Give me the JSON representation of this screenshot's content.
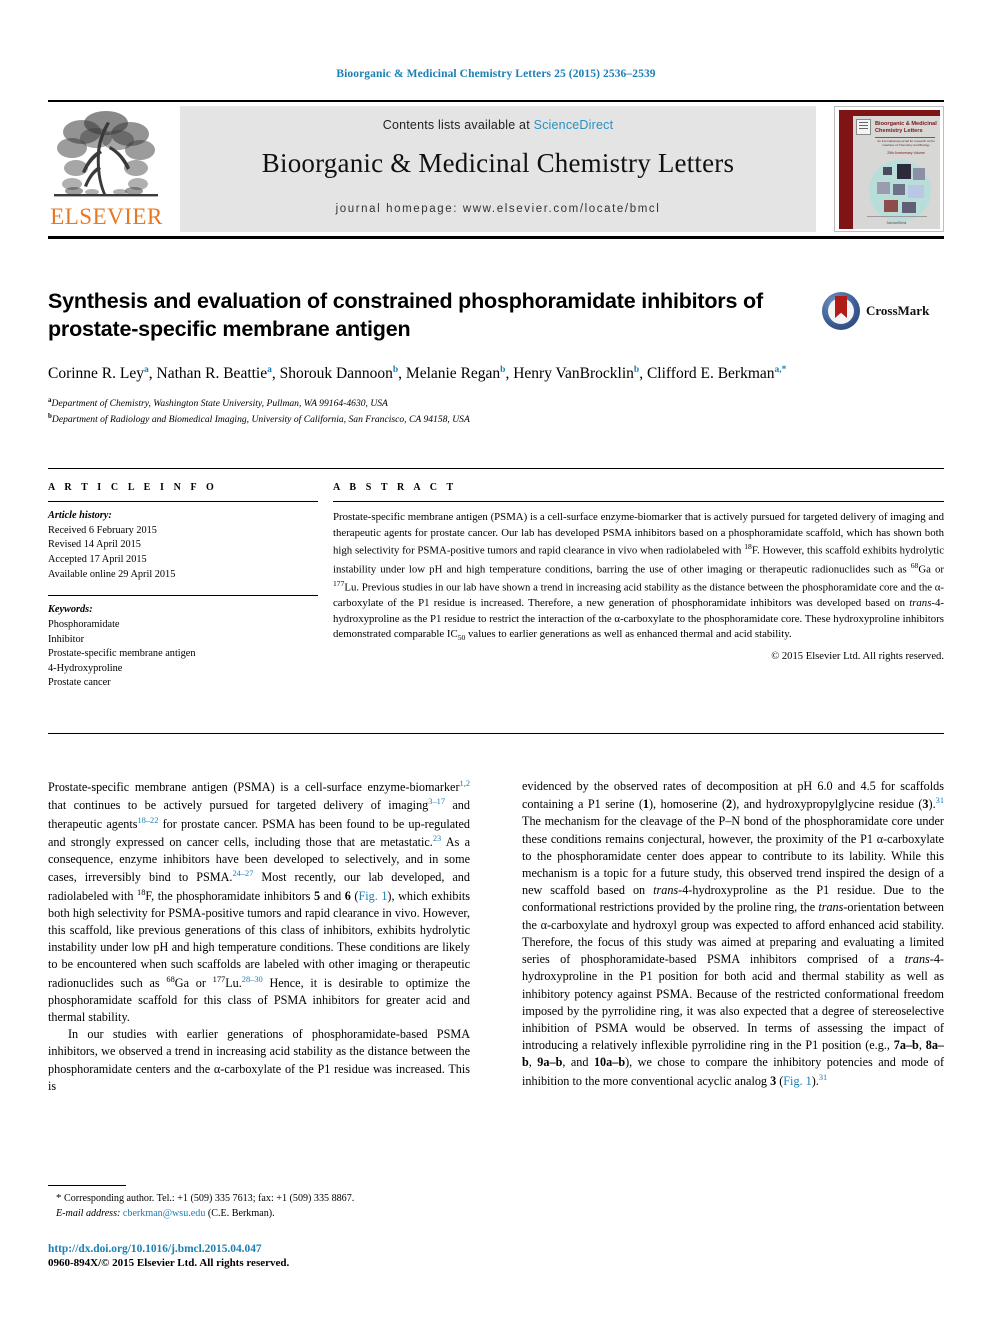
{
  "running_head": "Bioorganic & Medicinal Chemistry Letters 25 (2015) 2536–2539",
  "masthead": {
    "publisher_name": "ELSEVIER",
    "contents_prefix": "Contents lists available at",
    "sciencedirect_label": "ScienceDirect",
    "journal_title": "Bioorganic & Medicinal Chemistry Letters",
    "homepage_label": "journal homepage: www.elsevier.com/locate/bmcl",
    "cover": {
      "title": "Bioorganic & Medicinal Chemistry Letters",
      "subtitle": "An international journal for research at the interface of Chemistry and Biology",
      "volume_note": "25th Anniversary Volume",
      "footer": "ScienceDirect"
    },
    "colors": {
      "link_blue": "#2b8fc4",
      "elsevier_orange": "#e87722",
      "banner_grey": "#e4e4e4",
      "cover_red": "#7e1416"
    }
  },
  "article": {
    "title": "Synthesis and evaluation of constrained phosphoramidate inhibitors of prostate-specific membrane antigen",
    "crossmark_label": "CrossMark",
    "authors_html": "Corinne R. Ley<sup>a</sup>, Nathan R. Beattie<sup>a</sup>, Shorouk Dannoon<sup>b</sup>, Melanie Regan<sup>b</sup>, Henry VanBrocklin<sup>b</sup>, Clifford E. Berkman<sup>a,*</sup>",
    "affiliations": [
      {
        "marker": "a",
        "text": "Department of Chemistry, Washington State University, Pullman, WA 99164-4630, USA"
      },
      {
        "marker": "b",
        "text": "Department of Radiology and Biomedical Imaging, University of California, San Francisco, CA 94158, USA"
      }
    ]
  },
  "article_info": {
    "heading": "A R T I C L E    I N F O",
    "history_label": "Article history:",
    "history": [
      "Received 6 February 2015",
      "Revised 14 April 2015",
      "Accepted 17 April 2015",
      "Available online 29 April 2015"
    ],
    "keywords_label": "Keywords:",
    "keywords": [
      "Phosphoramidate",
      "Inhibitor",
      "Prostate-specific membrane antigen",
      "4-Hydroxyproline",
      "Prostate cancer"
    ]
  },
  "abstract": {
    "heading": "A B S T R A C T",
    "text_html": "Prostate-specific membrane antigen (PSMA) is a cell-surface enzyme-biomarker that is actively pursued for targeted delivery of imaging and therapeutic agents for prostate cancer. Our lab has developed PSMA inhibitors based on a phosphoramidate scaffold, which has shown both high selectivity for PSMA-positive tumors and rapid clearance in vivo when radiolabeled with <sup>18</sup>F. However, this scaffold exhibits hydrolytic instability under low pH and high temperature conditions, barring the use of other imaging or therapeutic radionuclides such as <sup>68</sup>Ga or <sup>177</sup>Lu. Previous studies in our lab have shown a trend in increasing acid stability as the distance between the phosphoramidate core and the &alpha;-carboxylate of the P1 residue is increased. Therefore, a new generation of phosphoramidate inhibitors was developed based on <i>trans</i>-4-hydroxyproline as the P1 residue to restrict the interaction of the &alpha;-carboxylate to the phosphoramidate core. These hydroxyproline inhibitors demonstrated comparable IC<sub>50</sub> values to earlier generations as well as enhanced thermal and acid stability.",
    "copyright": "© 2015 Elsevier Ltd. All rights reserved."
  },
  "body": {
    "left_column_html": "<p class=\"noindent\">Prostate-specific membrane antigen (PSMA) is a cell-surface enzyme-biomarker<sup class=\"cit\">1,2</sup> that continues to be actively pursued for targeted delivery of imaging<sup class=\"cit\">3–17</sup> and therapeutic agents<sup class=\"cit\">18–22</sup> for prostate cancer. PSMA has been found to be up-regulated and strongly expressed on cancer cells, including those that are metastatic.<sup class=\"cit\">23</sup> As a consequence, enzyme inhibitors have been developed to selectively, and in some cases, irreversibly bind to PSMA.<sup class=\"cit\">24–27</sup> Most recently, our lab developed, and radiolabeled with <sup>18</sup>F, the phosphoramidate inhibitors <b>5</b> and <b>6</b> (<span class=\"figref\">Fig. 1</span>), which exhibits both high selectivity for PSMA-positive tumors and rapid clearance in vivo. However, this scaffold, like previous generations of this class of inhibitors, exhibits hydrolytic instability under low pH and high temperature conditions. These conditions are likely to be encountered when such scaffolds are labeled with other imaging or therapeutic radionuclides such as <sup>68</sup>Ga or <sup>177</sup>Lu.<sup class=\"cit\">28–30</sup> Hence, it is desirable to optimize the phosphoramidate scaffold for this class of PSMA inhibitors for greater acid and thermal stability.</p><p>In our studies with earlier generations of phosphoramidate-based PSMA inhibitors, we observed a trend in increasing acid stability as the distance between the phosphoramidate centers and the &alpha;-carboxylate of the P1 residue was increased. This is</p>",
    "right_column_html": "<p class=\"noindent\">evidenced by the observed rates of decomposition at pH 6.0 and 4.5 for scaffolds containing a P1 serine (<b>1</b>), homoserine (<b>2</b>), and hydroxypropylglycine residue (<b>3</b>).<sup class=\"cit\">31</sup> The mechanism for the cleavage of the P–N bond of the phosphoramidate core under these conditions remains conjectural, however, the proximity of the P1 &alpha;-carboxylate to the phosphoramidate center does appear to contribute to its lability. While this mechanism is a topic for a future study, this observed trend inspired the design of a new scaffold based on <i>trans</i>-4-hydroxyproline as the P1 residue. Due to the conformational restrictions provided by the proline ring, the <i>trans</i>-orientation between the &alpha;-carboxylate and hydroxyl group was expected to afford enhanced acid stability. Therefore, the focus of this study was aimed at preparing and evaluating a limited series of phosphoramidate-based PSMA inhibitors comprised of a <i>trans</i>-4-hydroxyproline in the P1 position for both acid and thermal stability as well as inhibitory potency against PSMA. Because of the restricted conformational freedom imposed by the pyrrolidine ring, it was also expected that a degree of stereoselective inhibition of PSMA would be observed. In terms of assessing the impact of introducing a relatively inflexible pyrrolidine ring in the P1 position (e.g., <b>7a–b</b>, <b>8a–b</b>, <b>9a–b</b>, and <b>10a–b</b>), we chose to compare the inhibitory potencies and mode of inhibition to the more conventional acyclic analog <b>3</b> (<span class=\"figref\">Fig. 1</span>).<sup class=\"cit\">31</sup></p>"
  },
  "footer": {
    "corresponding_html": "<span style=\"font-size:11px\">*</span> Corresponding author. Tel.: +1 (509) 335 7613; fax: +1 (509) 335 8867.",
    "email_label": "E-mail address:",
    "email": "cberkman@wsu.edu",
    "email_owner": "(C.E. Berkman).",
    "doi": "http://dx.doi.org/10.1016/j.bmcl.2015.04.047",
    "issn_line": "0960-894X/© 2015 Elsevier Ltd. All rights reserved."
  }
}
